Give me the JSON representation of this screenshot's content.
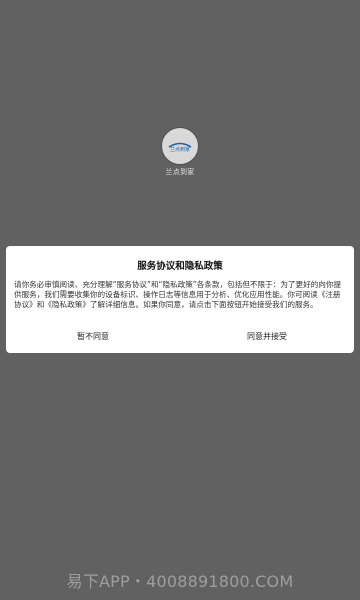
{
  "splash": {
    "app_name": "兰点到家",
    "logo_text": "兰点到家"
  },
  "dialog": {
    "title": "服务协议和隐私政策",
    "body": "请你务必审慎阅读、充分理解“服务协议”和“隐私政策”各条款，包括但不限于：为了更好的向你提供服务，我们需要收集你的设备标识、操作日志等信息用于分析、优化应用性能。你可阅读《注册协议》和《隐私政策》了解详细信息。如果你同意，请点击下面按钮开始接受我们的服务。",
    "disagree_label": "暂不同意",
    "agree_label": "同意并接受"
  },
  "watermark": {
    "text": "易下APP・4008891800.COM"
  },
  "colors": {
    "overlay": "#616161",
    "dialog_bg": "#ffffff",
    "logo_accent": "#1f5fa8"
  }
}
